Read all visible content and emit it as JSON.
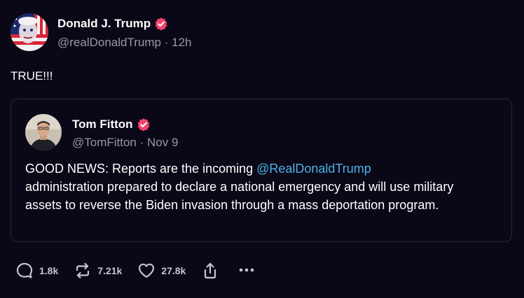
{
  "post": {
    "author": {
      "display_name": "Donald J. Trump",
      "handle": "@realDonaldTrump",
      "separator": "·",
      "time": "12h",
      "verified": true,
      "avatar_icon": "flag-portrait-avatar"
    },
    "text": "TRUE!!!",
    "quote": {
      "author": {
        "display_name": "Tom Fitton",
        "handle": "@TomFitton",
        "separator": "·",
        "date": "Nov 9",
        "verified": true,
        "avatar_icon": "portrait-avatar"
      },
      "body_before": "GOOD NEWS: Reports are the incoming ",
      "mention": "@RealDonaldTrump",
      "body_after": " administration prepared to declare a national emergency and will use military assets to reverse the Biden invasion through a mass deportation program."
    },
    "actions": {
      "replies": "1.8k",
      "reposts": "7.21k",
      "likes": "27.8k",
      "share_icon": "share-icon",
      "more_icon": "more-icon"
    }
  },
  "colors": {
    "background": "#0a0716",
    "verified_badge": "#f0436f",
    "mention": "#4db3e6",
    "muted_text": "#9b98a6",
    "quote_border": "#2a2738"
  }
}
